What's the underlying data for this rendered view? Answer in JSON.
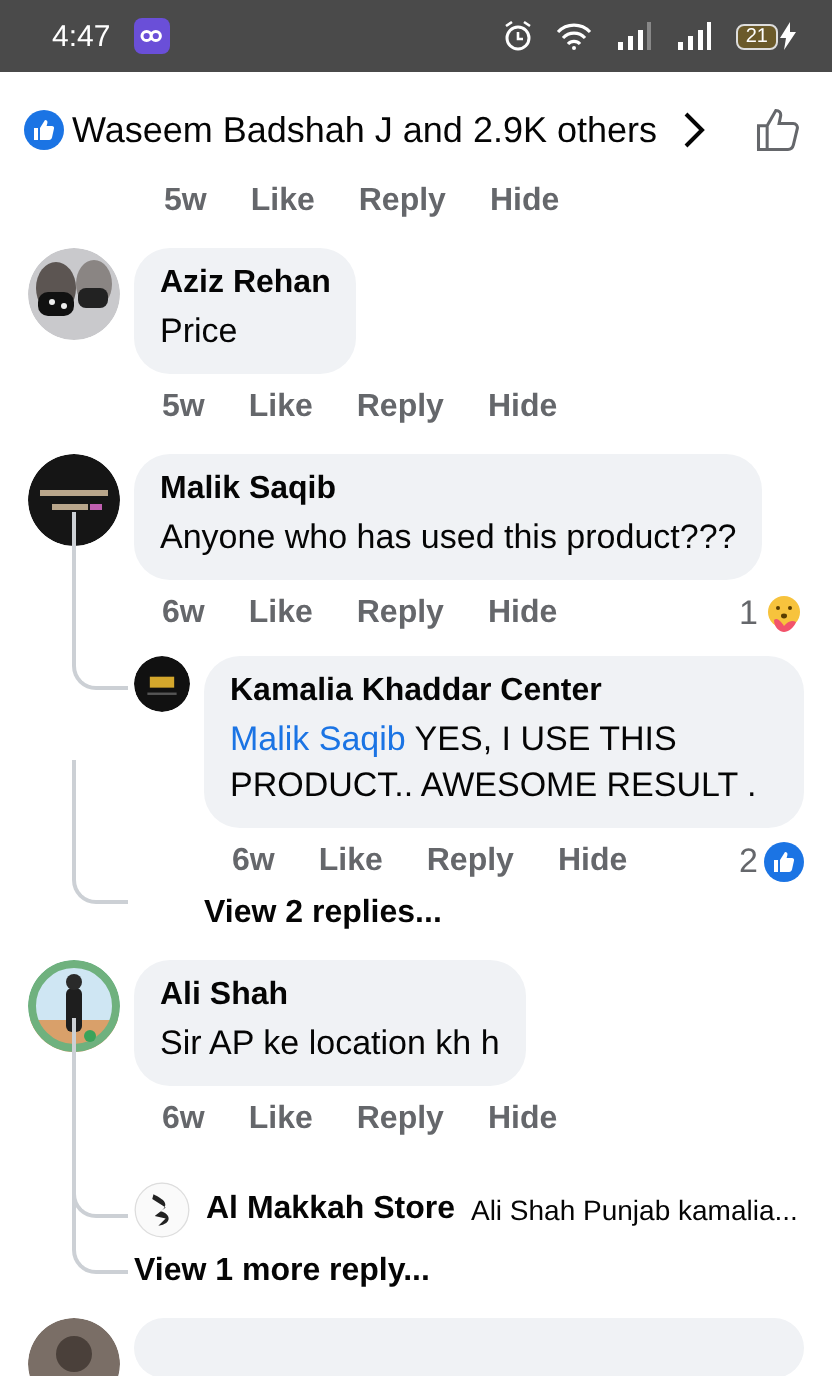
{
  "status_bar": {
    "time": "4:47",
    "battery": "21"
  },
  "likes": {
    "text": "Waseem Badshah J and 2.9K others"
  },
  "top_actions": {
    "time": "5w",
    "buttons": [
      "Like",
      "Reply",
      "Hide"
    ]
  },
  "comments": [
    {
      "author": "Aziz Rehan",
      "text": "Price",
      "time": "5w",
      "buttons": [
        "Like",
        "Reply",
        "Hide"
      ]
    },
    {
      "author": "Malik Saqib",
      "text": "Anyone who has used this product???",
      "time": "6w",
      "buttons": [
        "Like",
        "Reply",
        "Hide"
      ],
      "reaction": {
        "kind": "care",
        "count": "1"
      },
      "replies": [
        {
          "author": "Kamalia Khaddar Center",
          "mention": "Malik Saqib",
          "text": "YES, I USE THIS PRODUCT.. AWESOME RESULT .",
          "time": "6w",
          "buttons": [
            "Like",
            "Reply",
            "Hide"
          ],
          "reaction": {
            "kind": "like",
            "count": "2"
          }
        }
      ],
      "view_more": "View 2 replies..."
    },
    {
      "author": "Ali Shah",
      "text": "Sir AP ke location kh h",
      "time": "6w",
      "buttons": [
        "Like",
        "Reply",
        "Hide"
      ],
      "reply_preview": {
        "author": "Al Makkah Store",
        "text": "Ali Shah Punjab kamalia..."
      },
      "view_more": "View 1 more reply..."
    }
  ]
}
